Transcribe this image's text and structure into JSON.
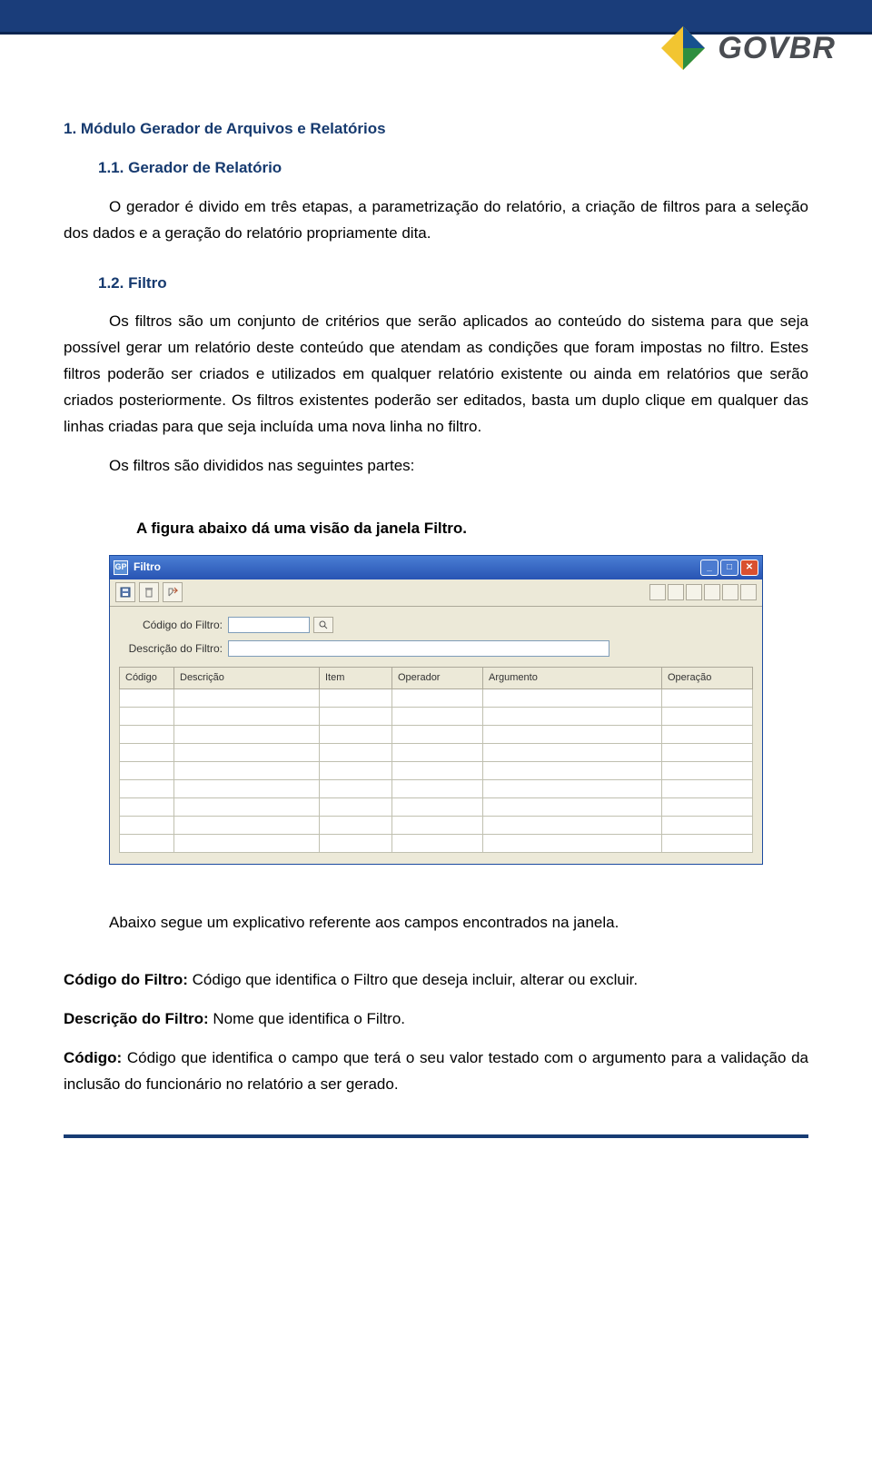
{
  "logo_text": "GOVBR",
  "section1": {
    "num": "1.",
    "title": "Módulo Gerador de Arquivos e Relatórios",
    "sub1_num": "1.1.",
    "sub1_title": "Gerador de Relatório",
    "sub1_body": "O gerador é divido em três etapas, a parametrização do relatório, a criação de filtros para a seleção dos dados e a geração do relatório propriamente dita.",
    "sub2_num": "1.2.",
    "sub2_title": "Filtro",
    "sub2_p1": "Os filtros são um conjunto de critérios que serão aplicados ao conteúdo do sistema para que seja possível gerar um relatório deste conteúdo que atendam as condições que foram impostas no filtro. Estes filtros poderão ser criados e utilizados em qualquer relatório existente ou ainda em relatórios que serão criados posteriormente. Os filtros existentes poderão ser editados, basta um duplo clique em qualquer das linhas criadas para que seja incluída uma nova linha no filtro.",
    "sub2_p2": "Os filtros são divididos nas seguintes partes:",
    "caption": "A figura abaixo dá uma visão da janela Filtro.",
    "post_img": "Abaixo segue um explicativo referente aos campos encontrados na janela.",
    "defs": {
      "d1_label": "Código do Filtro:",
      "d1_text": " Código que identifica o Filtro que deseja incluir, alterar ou excluir.",
      "d2_label": "Descrição do Filtro:",
      "d2_text": " Nome que identifica o Filtro.",
      "d3_label": "Código:",
      "d3_text": " Código que identifica o campo que terá o seu valor testado com o argumento para a validação da inclusão do funcionário no relatório a ser gerado."
    }
  },
  "filtro_window": {
    "title": "Filtro",
    "form": {
      "codigo_label": "Código do Filtro:",
      "descricao_label": "Descrição do Filtro:",
      "codigo_value": "",
      "descricao_value": ""
    },
    "columns": [
      "Código",
      "Descrição",
      "Item",
      "Operador",
      "Argumento",
      "Operação"
    ],
    "row_count": 9
  }
}
